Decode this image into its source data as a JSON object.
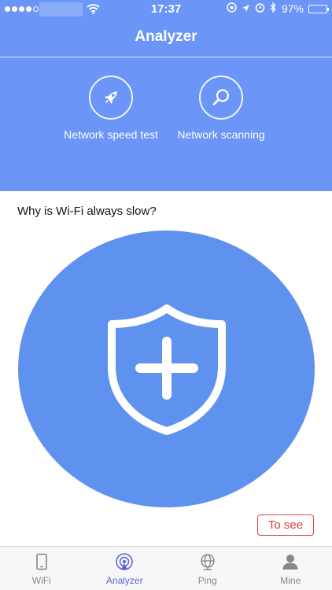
{
  "status_bar": {
    "time": "17:37",
    "battery": "97%",
    "battery_level": 0.97
  },
  "header": {
    "title": "Analyzer",
    "actions": [
      {
        "label": "Network speed test",
        "icon": "rocket-icon"
      },
      {
        "label": "Network scanning",
        "icon": "search-icon"
      }
    ]
  },
  "card": {
    "question": "Why is Wi-Fi always slow?",
    "hero_icon": "shield-plus-icon",
    "button_label": "To see"
  },
  "tabbar": {
    "tabs": [
      {
        "label": "WiFi",
        "icon": "phone-icon",
        "active": false
      },
      {
        "label": "Analyzer",
        "icon": "broadcast-icon",
        "active": true
      },
      {
        "label": "Ping",
        "icon": "globe-icon",
        "active": false
      },
      {
        "label": "Mine",
        "icon": "person-icon",
        "active": false
      }
    ]
  },
  "colors": {
    "header_bg": "#6b95f7",
    "hero_circle": "#5e92ee",
    "accent_active": "#5a63d6",
    "button_red": "#e0403c"
  }
}
